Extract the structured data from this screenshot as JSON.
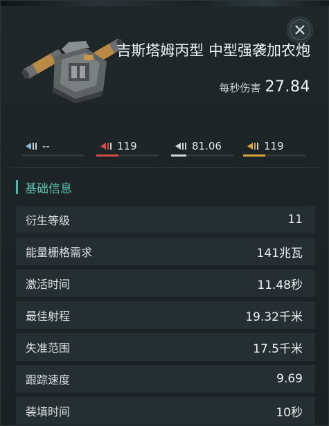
{
  "item": {
    "name": "吉斯塔姆丙型 中型强袭加农炮",
    "dps_label": "每秒伤害",
    "dps_value": "27.84"
  },
  "close_icon": "close-icon",
  "damage": [
    {
      "type": "em",
      "icon": "em-damage-icon",
      "value": "--",
      "color": "#8fb8d8",
      "fill": 0
    },
    {
      "type": "thermal",
      "icon": "thermal-damage-icon",
      "value": "119",
      "color": "#d24a4a",
      "fill": 0.35
    },
    {
      "type": "kinetic",
      "icon": "kinetic-damage-icon",
      "value": "81.06",
      "color": "#cfd6d8",
      "fill": 0.24
    },
    {
      "type": "explosive",
      "icon": "explosive-damage-icon",
      "value": "119",
      "color": "#d9a23a",
      "fill": 0.35
    }
  ],
  "section": {
    "title": "基础信息"
  },
  "attributes": [
    {
      "label": "衍生等级",
      "value": "11"
    },
    {
      "label": "能量栅格需求",
      "value": "141兆瓦"
    },
    {
      "label": "激活时间",
      "value": "11.48秒"
    },
    {
      "label": "最佳射程",
      "value": "19.32千米"
    },
    {
      "label": "失准范围",
      "value": "17.5千米"
    },
    {
      "label": "跟踪速度",
      "value": "9.69"
    },
    {
      "label": "装填时间",
      "value": "10秒"
    }
  ]
}
